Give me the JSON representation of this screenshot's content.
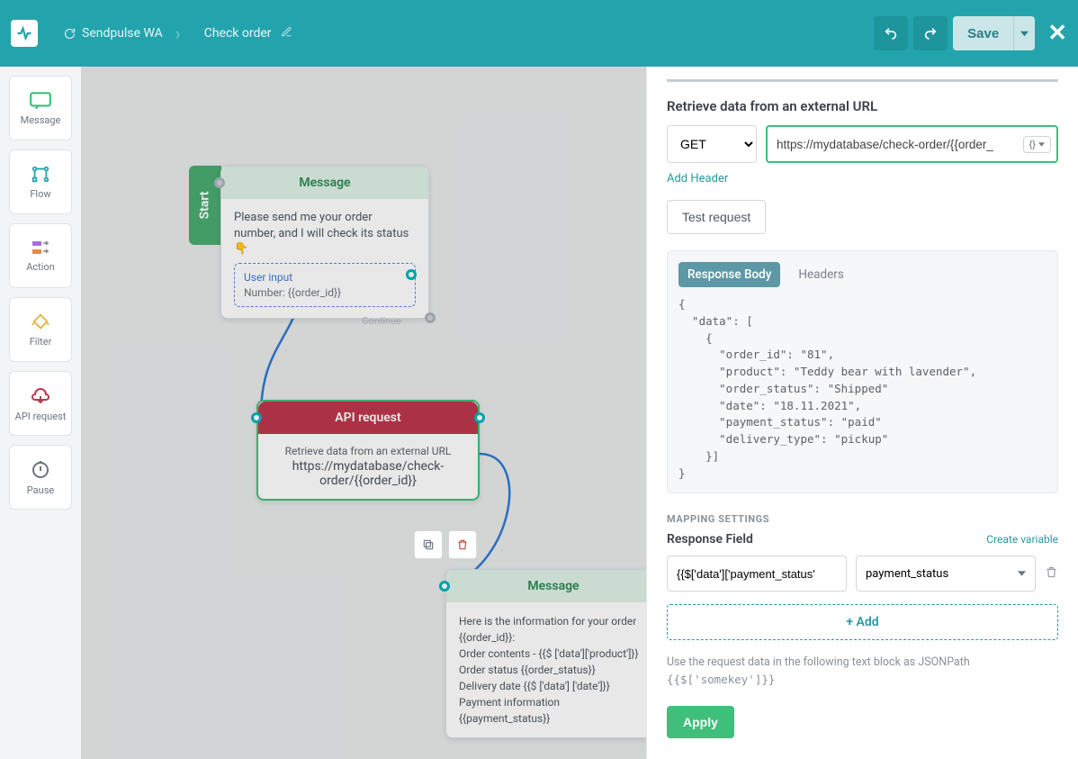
{
  "header": {
    "breadcrumb_app": "Sendpulse WA",
    "breadcrumb_flow": "Check order",
    "save_label": "Save"
  },
  "toolbox": {
    "items": [
      {
        "label": "Message",
        "icon": "message-icon"
      },
      {
        "label": "Flow",
        "icon": "flow-icon"
      },
      {
        "label": "Action",
        "icon": "action-icon"
      },
      {
        "label": "Filter",
        "icon": "filter-icon"
      },
      {
        "label": "API request",
        "icon": "api-icon"
      },
      {
        "label": "Pause",
        "icon": "pause-icon"
      }
    ]
  },
  "canvas": {
    "start_label": "Start",
    "node1": {
      "title": "Message",
      "text": "Please send me your order number, and I will check its status",
      "user_input_title": "User input",
      "user_input_value": "Number: {{order_id}}",
      "continue_ghost": "Continue"
    },
    "node2": {
      "title": "API request",
      "desc": "Retrieve data from an external URL",
      "url": "https://mydatabase/check-order/{{order_id}}"
    },
    "node3": {
      "title": "Message",
      "body": "Here is the information for your order {{order_id}}:\nOrder contents - {{$ ['data']['product']}}\nOrder status {{order_status}}\nDelivery date {{$ ['data'] ['date']}}\nPayment information {{payment_status}}"
    }
  },
  "panel": {
    "title": "Retrieve data from an external URL",
    "method": "GET",
    "url_value": "https://mydatabase/check-order/{{order_",
    "var_chip": "{}",
    "add_header": "Add Header",
    "test_request": "Test request",
    "tab_body": "Response Body",
    "tab_headers": "Headers",
    "response_text": "{\n  \"data\": [\n    {\n      \"order_id\": \"81\",\n      \"product\": \"Teddy bear with lavender\",\n      \"order_status\": \"Shipped\"\n      \"date\": \"18.11.2021\",\n      \"payment_status\": \"paid\"\n      \"delivery_type\": \"pickup\"\n    }]\n}",
    "mapping_head": "MAPPING SETTINGS",
    "response_field": "Response Field",
    "create_variable": "Create variable",
    "mapping_input_value": "{{$['data']['payment_status'",
    "mapping_select_value": "payment_status",
    "add_mapping": "+ Add",
    "hint_line1": "Use the request data in the following text block as JSONPath",
    "hint_line2": "{{$['somekey']}}",
    "apply": "Apply"
  }
}
